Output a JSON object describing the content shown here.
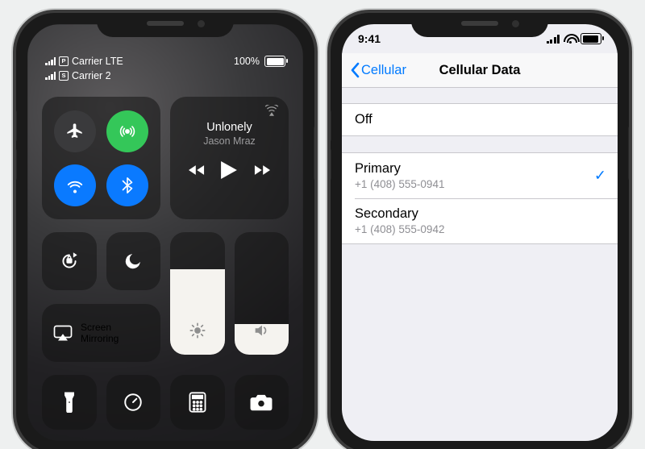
{
  "left_phone": {
    "status": {
      "carrier1_tag": "P",
      "carrier1_text": "Carrier LTE",
      "carrier2_tag": "S",
      "carrier2_text": "Carrier 2",
      "battery_text": "100%"
    },
    "connectivity": {
      "airplane_on": false,
      "cellular_on": true,
      "wifi_on": true,
      "bluetooth_on": true
    },
    "music": {
      "title": "Unlonely",
      "artist": "Jason Mraz"
    },
    "screen_mirroring_label": "Screen\nMirroring",
    "brightness_percent": 70,
    "volume_percent": 25
  },
  "right_phone": {
    "status": {
      "time": "9:41"
    },
    "nav": {
      "back": "Cellular",
      "title": "Cellular Data"
    },
    "options": {
      "off": {
        "label": "Off"
      },
      "primary": {
        "label": "Primary",
        "number": "+1 (408) 555-0941",
        "selected": true
      },
      "secondary": {
        "label": "Secondary",
        "number": "+1 (408) 555-0942",
        "selected": false
      }
    }
  }
}
